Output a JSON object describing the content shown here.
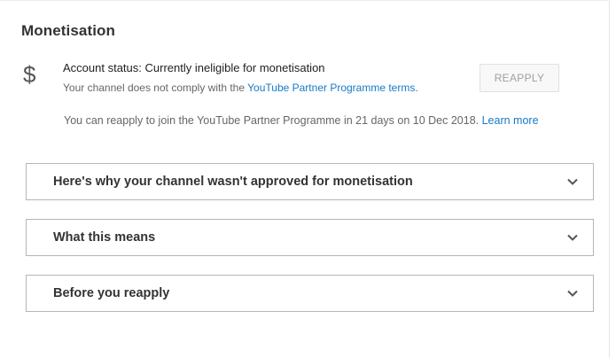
{
  "section": {
    "title": "Monetisation"
  },
  "status": {
    "icon": "dollar-icon",
    "line": "Account status: Currently ineligible for monetisation",
    "sub_prefix": "Your channel does not comply with the ",
    "sub_link": "YouTube Partner Programme terms",
    "sub_suffix": ".",
    "reapply_label": "REAPPLY"
  },
  "info": {
    "text": "You can reapply to join the YouTube Partner Programme in 21 days on 10 Dec 2018. ",
    "link": "Learn more"
  },
  "accordions": [
    {
      "label": "Here's why your channel wasn't approved for monetisation",
      "icon": "chevron-down-icon"
    },
    {
      "label": "What this means",
      "icon": "chevron-down-icon"
    },
    {
      "label": "Before you reapply",
      "icon": "chevron-down-icon"
    }
  ],
  "colors": {
    "link": "#167ac6",
    "border": "#b5b5b5",
    "muted_text": "#666666"
  }
}
